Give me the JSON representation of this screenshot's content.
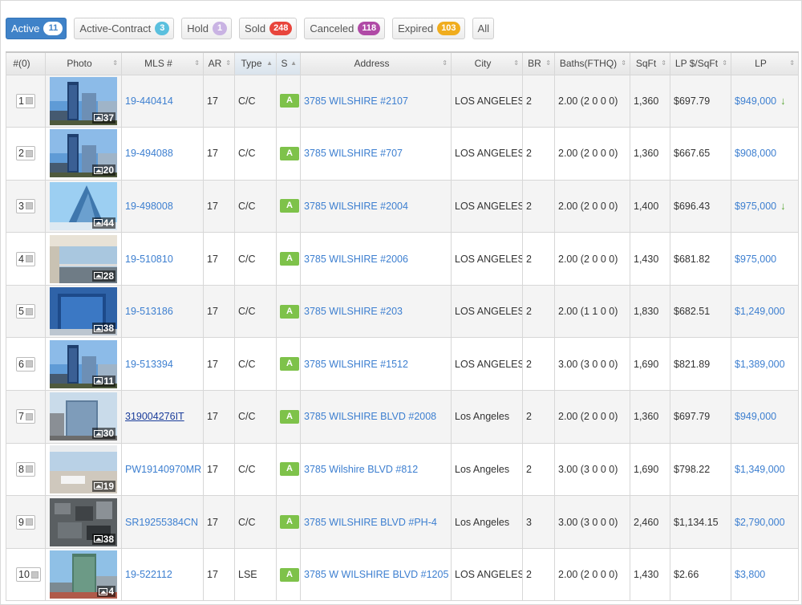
{
  "tabs": [
    {
      "label": "Active",
      "count": "11",
      "color": "#3f82c8",
      "active": true
    },
    {
      "label": "Active-Contract",
      "count": "3",
      "color": "#5bc0de"
    },
    {
      "label": "Hold",
      "count": "1",
      "color": "#c9b3e3"
    },
    {
      "label": "Sold",
      "count": "248",
      "color": "#e8453c"
    },
    {
      "label": "Canceled",
      "count": "118",
      "color": "#b04aa6"
    },
    {
      "label": "Expired",
      "count": "103",
      "color": "#f0ad1e"
    },
    {
      "label": "All",
      "count": null
    }
  ],
  "columns": [
    {
      "label": "#(0)",
      "sort": ""
    },
    {
      "label": "Photo",
      "sort": "⇕"
    },
    {
      "label": "MLS #",
      "sort": "⇕"
    },
    {
      "label": "AR",
      "sort": "⇕"
    },
    {
      "label": "Type",
      "sort": "▲"
    },
    {
      "label": "S",
      "sort": "▲"
    },
    {
      "label": "Address",
      "sort": "⇕"
    },
    {
      "label": "City",
      "sort": "⇕"
    },
    {
      "label": "BR",
      "sort": "⇕"
    },
    {
      "label": "Baths(FTHQ)",
      "sort": "⇕"
    },
    {
      "label": "SqFt",
      "sort": "⇕"
    },
    {
      "label": "LP $/SqFt",
      "sort": "⇕"
    },
    {
      "label": "LP",
      "sort": "⇕"
    }
  ],
  "rows": [
    {
      "no": "1",
      "photos": "37",
      "photo_style": "tower-blue",
      "mls": "19-440414",
      "ar": "17",
      "type": "C/C",
      "status": "A",
      "address": "3785 WILSHIRE #2107",
      "city": "LOS ANGELES",
      "br": "2",
      "baths": "2.00 (2 0 0 0)",
      "sqft": "1,360",
      "lp_sqft": "$697.79",
      "lp": "$949,000",
      "price_down": true
    },
    {
      "no": "2",
      "photos": "20",
      "photo_style": "tower-blue",
      "mls": "19-494088",
      "ar": "17",
      "type": "C/C",
      "status": "A",
      "address": "3785 WILSHIRE #707",
      "city": "LOS ANGELES",
      "br": "2",
      "baths": "2.00 (2 0 0 0)",
      "sqft": "1,360",
      "lp_sqft": "$667.65",
      "lp": "$908,000",
      "price_down": false
    },
    {
      "no": "3",
      "photos": "44",
      "photo_style": "glass-sky",
      "mls": "19-498008",
      "ar": "17",
      "type": "C/C",
      "status": "A",
      "address": "3785 WILSHIRE #2004",
      "city": "LOS ANGELES",
      "br": "2",
      "baths": "2.00 (2 0 0 0)",
      "sqft": "1,400",
      "lp_sqft": "$696.43",
      "lp": "$975,000",
      "price_down": true
    },
    {
      "no": "4",
      "photos": "28",
      "photo_style": "balcony",
      "mls": "19-510810",
      "ar": "17",
      "type": "C/C",
      "status": "A",
      "address": "3785 WILSHIRE #2006",
      "city": "LOS ANGELES",
      "br": "2",
      "baths": "2.00 (2 0 0 0)",
      "sqft": "1,430",
      "lp_sqft": "$681.82",
      "lp": "$975,000",
      "price_down": false
    },
    {
      "no": "5",
      "photos": "38",
      "photo_style": "glass-dark",
      "mls": "19-513186",
      "ar": "17",
      "type": "C/C",
      "status": "A",
      "address": "3785 WILSHIRE #203",
      "city": "LOS ANGELES",
      "br": "2",
      "baths": "2.00 (1 1 0 0)",
      "sqft": "1,830",
      "lp_sqft": "$682.51",
      "lp": "$1,249,000",
      "price_down": false
    },
    {
      "no": "6",
      "photos": "11",
      "photo_style": "tower-blue",
      "mls": "19-513394",
      "ar": "17",
      "type": "C/C",
      "status": "A",
      "address": "3785 WILSHIRE #1512",
      "city": "LOS ANGELES",
      "br": "2",
      "baths": "3.00 (3 0 0 0)",
      "sqft": "1,690",
      "lp_sqft": "$821.89",
      "lp": "$1,389,000",
      "price_down": false
    },
    {
      "no": "7",
      "photos": "30",
      "photo_style": "street",
      "mls": "319004276IT",
      "ar": "17",
      "type": "C/C",
      "status": "A",
      "address": "3785 WILSHIRE BLVD #2008",
      "city": "Los Angeles",
      "br": "2",
      "baths": "2.00 (2 0 0 0)",
      "sqft": "1,360",
      "lp_sqft": "$697.79",
      "lp": "$949,000",
      "price_down": false,
      "mls_underlined": true
    },
    {
      "no": "8",
      "photos": "19",
      "photo_style": "interior",
      "mls": "PW19140970MR",
      "ar": "17",
      "type": "C/C",
      "status": "A",
      "address": "3785 Wilshire BLVD #812",
      "city": "Los Angeles",
      "br": "2",
      "baths": "3.00 (3 0 0 0)",
      "sqft": "1,690",
      "lp_sqft": "$798.22",
      "lp": "$1,349,000",
      "price_down": false
    },
    {
      "no": "9",
      "photos": "38",
      "photo_style": "aerial",
      "mls": "SR19255384CN",
      "ar": "17",
      "type": "C/C",
      "status": "A",
      "address": "3785 WILSHIRE BLVD #PH-4",
      "city": "Los Angeles",
      "br": "3",
      "baths": "3.00 (3 0 0 0)",
      "sqft": "2,460",
      "lp_sqft": "$1,134.15",
      "lp": "$2,790,000",
      "price_down": false
    },
    {
      "no": "10",
      "photos": "4",
      "photo_style": "tower-green",
      "mls": "19-522112",
      "ar": "17",
      "type": "LSE",
      "status": "A",
      "address": "3785 W WILSHIRE BLVD #1205",
      "city": "LOS ANGELES",
      "br": "2",
      "baths": "2.00 (2 0 0 0)",
      "sqft": "1,430",
      "lp_sqft": "$2.66",
      "lp": "$3,800",
      "price_down": false
    }
  ],
  "colors": {
    "link": "#3d7fd0",
    "status_active": "#7ec24a",
    "price_down_arrow": "#5aa636"
  }
}
